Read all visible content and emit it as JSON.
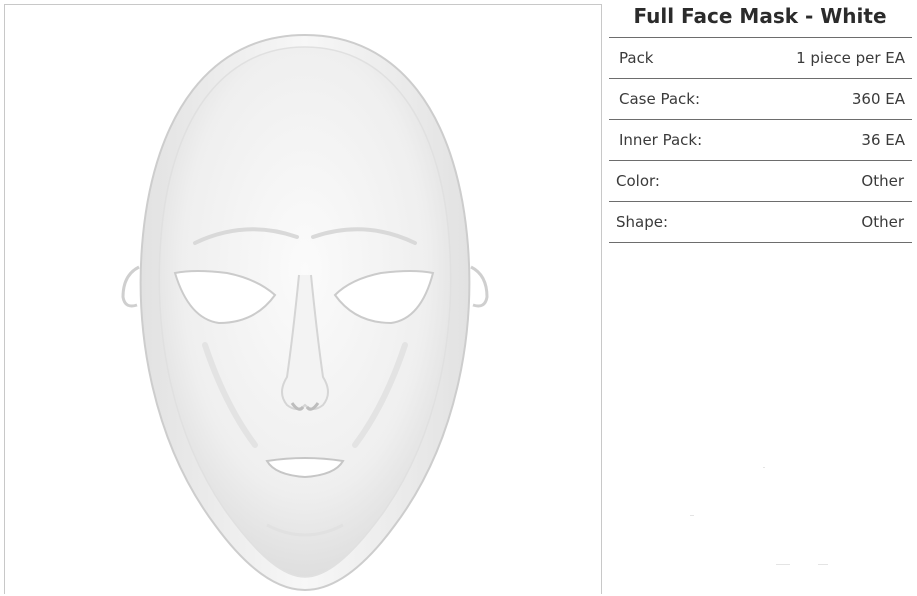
{
  "product": {
    "title": "Full Face Mask - White",
    "image_alt": "white full face mask"
  },
  "specs": [
    {
      "label": "Pack",
      "value": "1 piece per EA"
    },
    {
      "label": "Case Pack:",
      "value": "360 EA"
    },
    {
      "label": "Inner Pack:",
      "value": "36 EA"
    },
    {
      "label": "Color:",
      "value": "Other"
    },
    {
      "label": "Shape:",
      "value": "Other"
    }
  ],
  "colors": {
    "mask": "#f4f4f4",
    "mask_shadow": "#d6d6d6",
    "divider": "#6d6d6d",
    "text": "#333333"
  }
}
